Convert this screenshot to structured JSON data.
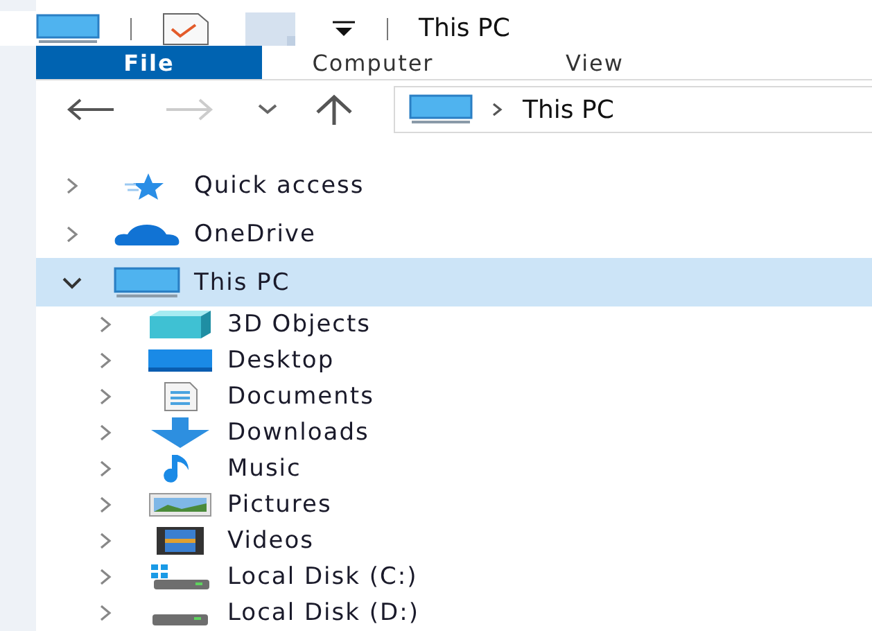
{
  "title_bar": {
    "title": "This PC"
  },
  "ribbon": {
    "tabs": [
      {
        "label": "File",
        "selected": true
      },
      {
        "label": "Computer",
        "selected": false
      },
      {
        "label": "View",
        "selected": false
      }
    ]
  },
  "address_bar": {
    "path": "This PC"
  },
  "navigation_pane": {
    "items": [
      {
        "label": "Quick access",
        "kind": "quick",
        "expanded": false,
        "selected": false
      },
      {
        "label": "OneDrive",
        "kind": "cloud",
        "expanded": false,
        "selected": false
      },
      {
        "label": "This PC",
        "kind": "pc",
        "expanded": true,
        "selected": true,
        "children": [
          {
            "label": "3D Objects",
            "kind": "cube",
            "expanded": false,
            "selected": false
          },
          {
            "label": "Desktop",
            "kind": "desktop",
            "expanded": false,
            "selected": false
          },
          {
            "label": "Documents",
            "kind": "documents",
            "expanded": false,
            "selected": false
          },
          {
            "label": "Downloads",
            "kind": "downloads",
            "expanded": false,
            "selected": false
          },
          {
            "label": "Music",
            "kind": "music",
            "expanded": false,
            "selected": false
          },
          {
            "label": "Pictures",
            "kind": "pictures",
            "expanded": false,
            "selected": false
          },
          {
            "label": "Videos",
            "kind": "videos",
            "expanded": false,
            "selected": false
          },
          {
            "label": "Local Disk (C:)",
            "kind": "system-disk",
            "expanded": false,
            "selected": false
          },
          {
            "label": "Local Disk (D:)",
            "kind": "disk",
            "expanded": false,
            "selected": false
          }
        ]
      }
    ]
  }
}
